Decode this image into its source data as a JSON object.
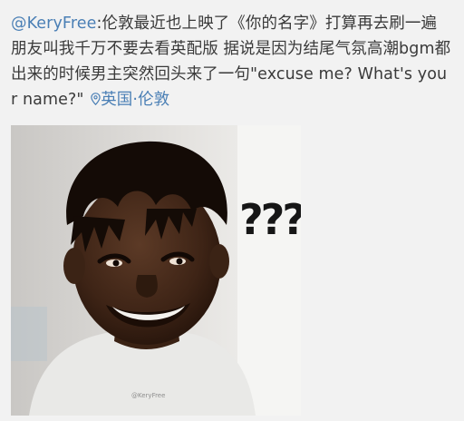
{
  "post": {
    "author_handle": "@KeryFree",
    "body": ":伦敦最近也上映了《你的名字》打算再去刷一遍 朋友叫我千万不要去看英配版 据说是因为结尾气氛高潮bgm都出来的时候男主突然回头来了一句\"excuse me? What's your name?\"",
    "location_icon": "location-pin-icon",
    "location": "英国·伦敦"
  },
  "media": {
    "caption_text": "???",
    "watermark": "@KeryFree"
  },
  "colors": {
    "link": "#4a7fb5",
    "text": "#3a3a3a",
    "background": "#f2f2f2"
  }
}
